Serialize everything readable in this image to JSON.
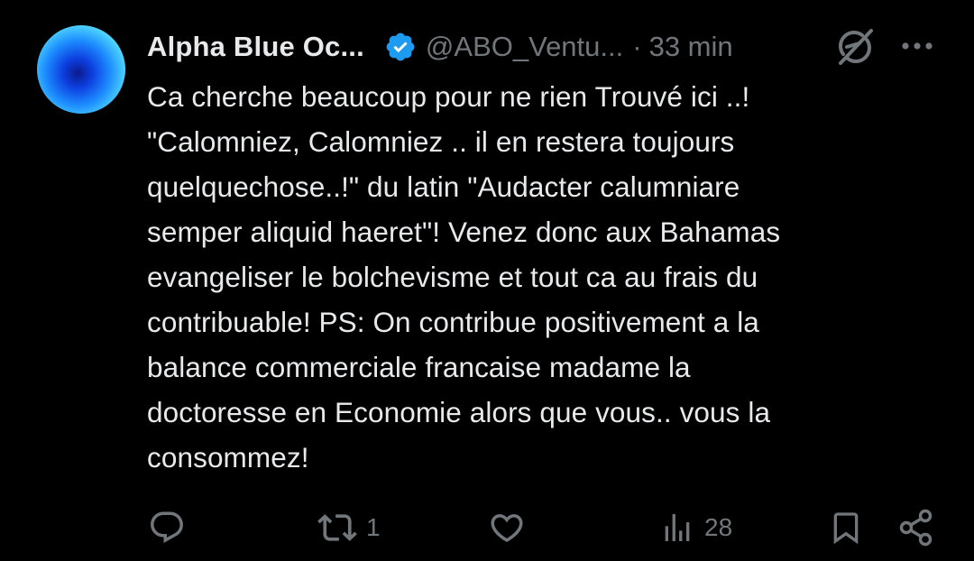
{
  "author": {
    "name": "Alpha Blue Oc...",
    "handle": "@ABO_Ventu...",
    "separator": "·",
    "time": "33 min"
  },
  "icons": {
    "avatar": "avatar-image",
    "verified": "verified-badge-icon",
    "grok": "grok-icon",
    "more": "more-icon",
    "reply": "reply-icon",
    "repost": "repost-icon",
    "like": "heart-icon",
    "views": "views-icon",
    "bookmark": "bookmark-icon",
    "share": "share-icon"
  },
  "colors": {
    "background": "#000000",
    "text": "#e7e9ea",
    "muted": "#71767b",
    "verified": "#1d9bf0"
  },
  "tweet": {
    "text": "Ca cherche beaucoup pour ne rien Trouvé ici ..!\n\"Calomniez, Calomniez .. il en restera toujours\nquelquechose..!\" du latin \"Audacter calumniare\nsemper aliquid haeret\"! Venez donc aux Bahamas\nevangeliser le bolchevisme et tout ca au frais du\ncontribuable! PS: On contribue positivement a la\nbalance commerciale francaise madame la\ndoctoresse en Economie alors que vous.. vous la\nconsommez!"
  },
  "actions": {
    "reply_count": "",
    "repost_count": "1",
    "like_count": "",
    "views_count": "28"
  }
}
